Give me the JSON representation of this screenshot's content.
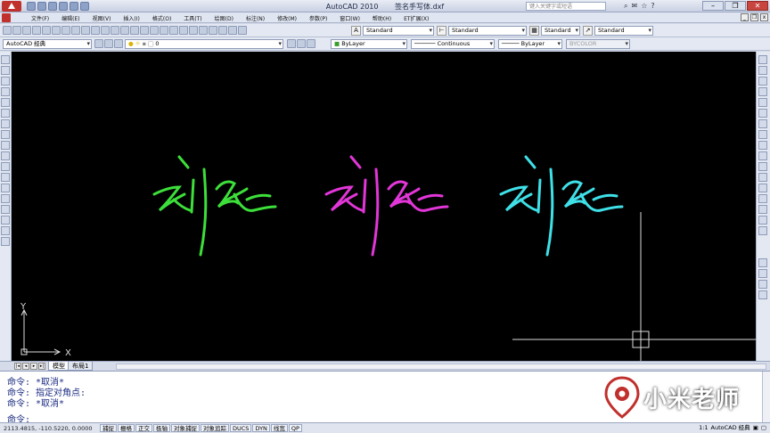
{
  "title": {
    "app_name": "AutoCAD 2010",
    "document_name": "签名手写体.dxf",
    "search_placeholder": "键入关键字或短语"
  },
  "menu": {
    "items": [
      "文件(F)",
      "编辑(E)",
      "视图(V)",
      "插入(I)",
      "格式(O)",
      "工具(T)",
      "绘图(D)",
      "标注(N)",
      "修改(M)",
      "参数(P)",
      "窗口(W)",
      "帮助(H)",
      "ET扩展(X)"
    ]
  },
  "toolbar": {
    "text_style": "Standard",
    "dim_style": "Standard",
    "table_style": "Standard",
    "mleader_style": "Standard"
  },
  "properties": {
    "workspace": "AutoCAD 经典",
    "layer": "0",
    "color": "ByLayer",
    "linetype": "Continuous",
    "lineweight": "ByLayer",
    "plotstyle": "BYCOLOR"
  },
  "canvas": {
    "ucs_x_label": "X",
    "ucs_y_label": "Y",
    "signature_colors": [
      "#3ddf3a",
      "#e236d8",
      "#3fe0e8"
    ]
  },
  "layout_tabs": {
    "model": "模型",
    "layout1": "布局1"
  },
  "command": {
    "lines": [
      "命令: *取消*",
      "命令: 指定对角点:",
      "命令: *取消*"
    ],
    "prompt": "命令:"
  },
  "status": {
    "coordinates": "2113.4815, -110.5220, 0.0000",
    "buttons": [
      "捕捉",
      "栅格",
      "正交",
      "极轴",
      "对象捕捉",
      "对象追踪",
      "DUCS",
      "DYN",
      "线宽",
      "QP"
    ],
    "workspace_label": "AutoCAD 经典",
    "scale": "1:1"
  },
  "watermark": {
    "text": "小米老师"
  }
}
